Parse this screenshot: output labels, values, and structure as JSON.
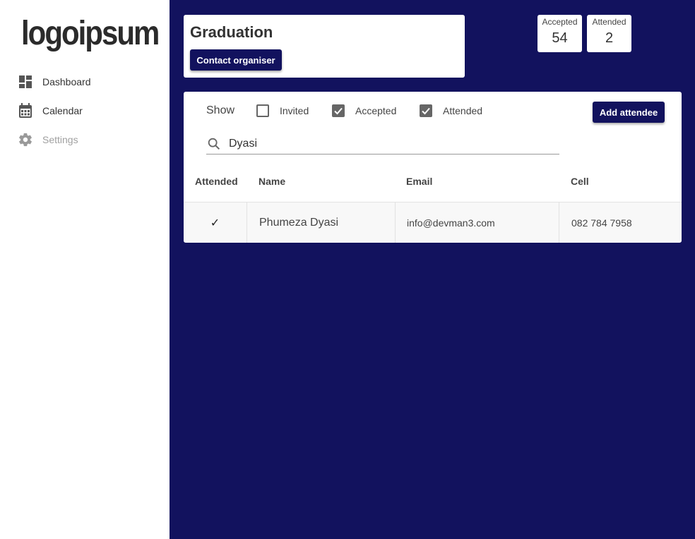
{
  "sidebar": {
    "logo_text": "logoipsum",
    "items": [
      {
        "label": "Dashboard",
        "icon": "dashboard-icon"
      },
      {
        "label": "Calendar",
        "icon": "calendar-icon"
      },
      {
        "label": "Settings",
        "icon": "gear-icon",
        "disabled": true
      }
    ]
  },
  "event": {
    "title": "Graduation",
    "contact_label": "Contact organiser"
  },
  "stats": [
    {
      "label": "Accepted",
      "value": "54"
    },
    {
      "label": "Attended",
      "value": "2"
    }
  ],
  "filters": {
    "show_label": "Show",
    "options": [
      {
        "label": "Invited",
        "checked": false
      },
      {
        "label": "Accepted",
        "checked": true
      },
      {
        "label": "Attended",
        "checked": true
      }
    ],
    "add_label": "Add attendee"
  },
  "search": {
    "value": "Dyasi"
  },
  "table": {
    "columns": [
      "Attended",
      "Name",
      "Email",
      "Cell"
    ],
    "rows": [
      {
        "attended": "✓",
        "name": "Phumeza Dyasi",
        "email": "info@devman3.com",
        "cell": "082 784 7958"
      }
    ]
  },
  "colors": {
    "brand": "#12125e",
    "background": "#12125e",
    "sidebar": "#ffffff"
  }
}
